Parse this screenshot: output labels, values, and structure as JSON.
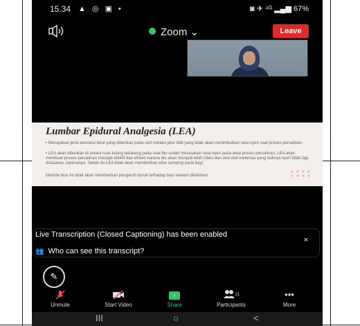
{
  "status_bar": {
    "time": "15.34",
    "left_icons": "▲ ◎ ▣ •",
    "right_status": "◙ ✈ ⁴ᴳ ▂▄▆ 67%"
  },
  "meeting": {
    "title": "Zoom",
    "title_chevron": "⌄",
    "leave_label": "Leave",
    "accent_color": "#e02a2a",
    "secure_color": "#3cc46b"
  },
  "slide": {
    "title": "Lumbar Epidural Analgesia (LEA)",
    "para1": "• Merupakan jenis anestesi lokal yang diberikan pada otot melalui jalur bilik yang tidak akan menimbulkan rasa nyeri saat proses persalinan",
    "para2": "• LEA akan diberikan di antara ruas tulang belakang pada saat ibu sudah merasakan rasa nyeri pada awal proses persalinan. LEA akan membuat proses persalinan menjadi efektif dan efisien karena ibu akan menjadi lebih rileks dan otot-otot melemas yang tadinya nyeri tidak lagi dirasakan, karenanya. Selain itu LEA tidak akan memberikan efek samping pada bayi.",
    "para3": "Metode bius ini tidak akan memberikan pengaruh buruk terhadap bayi setelah dilahirkan."
  },
  "transcript": {
    "message": "Live Transcription (Closed Captioning) has been enabled",
    "question": "Who can see this transcript?",
    "close": "×"
  },
  "toolbar": {
    "unmute": "Unmute",
    "start_video": "Start Video",
    "share": "Share",
    "participants": "Participants",
    "participants_count": "21",
    "more": "More",
    "share_color": "#2fc46a"
  },
  "navbar": {
    "recents": "III",
    "home": "○",
    "back": "<"
  }
}
